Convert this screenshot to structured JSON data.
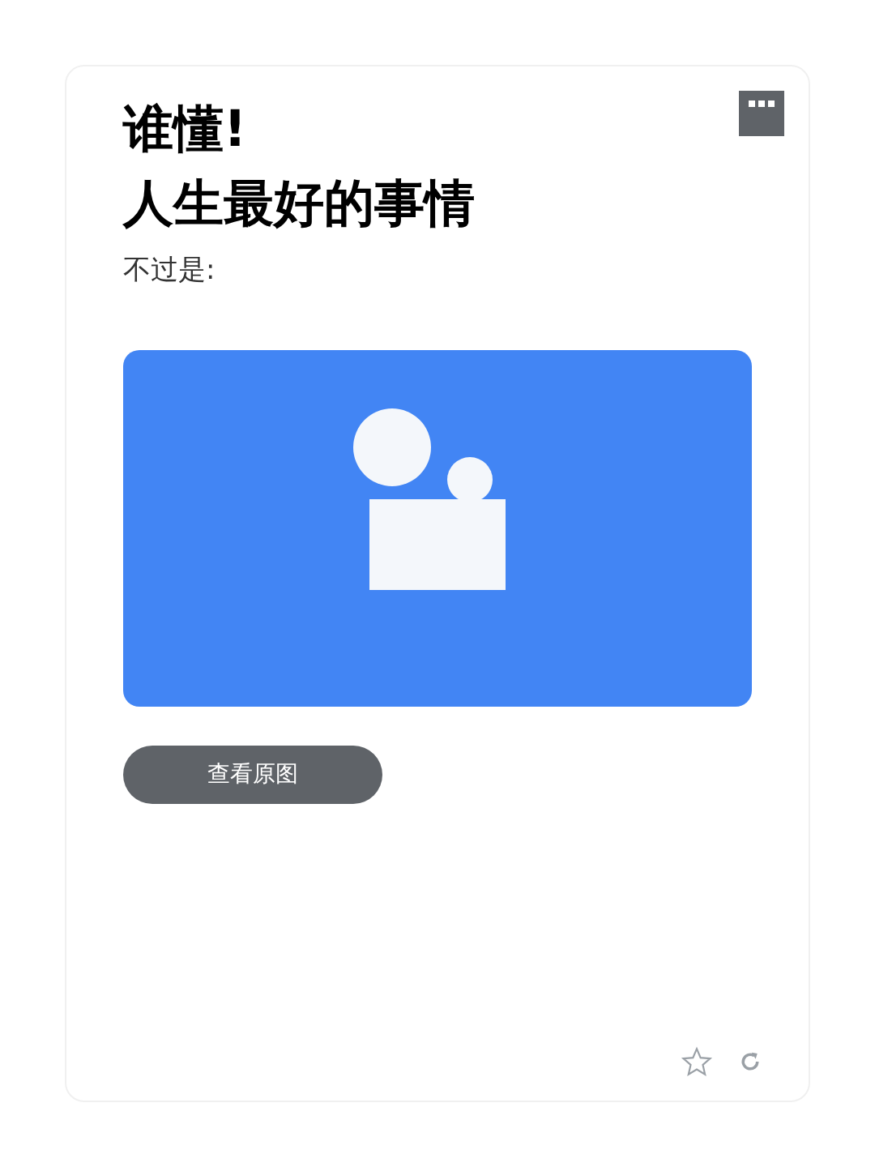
{
  "title_lines": [
    "谁懂!",
    "人生最好的事情"
  ],
  "subtitle": "不过是:",
  "image": {
    "kind": "placeholder"
  },
  "view_button": "查看原图"
}
